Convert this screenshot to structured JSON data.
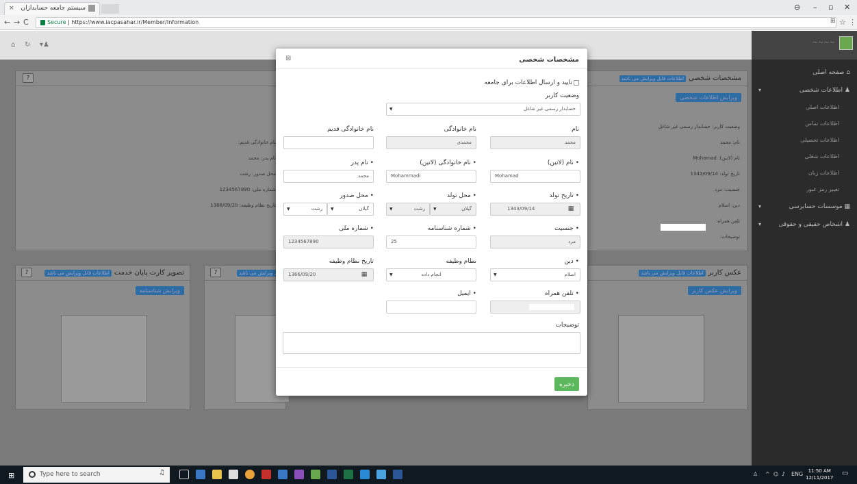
{
  "browser": {
    "tab_title": "سیستم جامعه حسابداران",
    "url_secure": "Secure",
    "url": "https://www.iacpasahar.ir/Member/Information"
  },
  "sidebar": {
    "items": [
      {
        "label": "صفحه اصلی"
      },
      {
        "label": "اطلاعات شخصی"
      }
    ],
    "subitems": [
      "اطلاعات اصلی",
      "اطلاعات تماس",
      "اطلاعات تحصیلی",
      "اطلاعات شغلی",
      "اطلاعات زبان",
      "تغییر رمز عبور"
    ],
    "bottom_items": [
      "موسسات حسابرسی",
      "اشخاص حقیقی و حقوقی"
    ]
  },
  "background": {
    "personal_title": "مشخصات شخصی",
    "editable_badge": "اطلاعات قابل ویرایش می باشد",
    "edit_personal_btn": "ویرایش اطلاعات شخصی",
    "right_lines": [
      "وضعیت کاربر: حسابدار رسمی غیر شاغل",
      "نام: محمد",
      "نام (لاتین): Mohamad",
      "تاریخ تولد: 1343/09/14",
      "جنسیت: مرد",
      "دین: اسلام",
      "تلفن همراه:",
      "توضیحات:"
    ],
    "left_lines": [
      "نام خانوادگی قدیم:",
      "نام پدر: محمد",
      "محل صدور: رشت",
      "شماره ملی: 1234567890",
      "تاریخ نظام وظیفه: 1366/09/20"
    ],
    "user_photo_title": "عکس کاربر",
    "edit_photo_btn": "ویرایش عکس کاربر",
    "service_card_title": "تصویر کارت پایان خدمت",
    "edit_id_btn": "ویرایش شناسنامه",
    "mid_badge": "ل ویرایش می باشد"
  },
  "modal": {
    "title": "مشخصات شخصی",
    "confirm_label": "تایید و ارسال اطلاعات برای جامعه",
    "user_status_label": "وضعیت کاربر",
    "user_status_value": "حسابدار رسمی غیر شاغل",
    "first_name_label": "نام",
    "first_name_value": "محمد",
    "last_name_label": "نام خانوادگی",
    "last_name_value": "محمدی",
    "old_last_name_label": "نام خانوادگی قدیم",
    "old_last_name_value": "",
    "first_name_latin_label": "• نام (لاتین)",
    "first_name_latin_value": "Mohamad",
    "last_name_latin_label": "• نام خانوادگی (لاتین)",
    "last_name_latin_value": "Mohammadi",
    "father_name_label": "• نام پدر",
    "father_name_value": "محمد",
    "birth_date_label": "• تاریخ تولد",
    "birth_date_value": "1343/09/14",
    "birth_place_label": "• محل تولد",
    "birth_province": "گیلان",
    "birth_city": "رشت",
    "issue_place_label": "• محل صدور",
    "issue_province": "گیلان",
    "issue_city": "رشت",
    "gender_label": "• جنسیت",
    "gender_value": "مرد",
    "id_number_label": "• شماره شناسنامه",
    "id_number_value": "25",
    "national_id_label": "• شماره ملی",
    "national_id_value": "1234567890",
    "religion_label": "• دین",
    "religion_value": "اسلام",
    "military_label": "نظام وظیفه",
    "military_value": "انجام داده",
    "military_date_label": "تاریخ نظام وظیفه",
    "military_date_value": "1366/09/20",
    "mobile_label": "• تلفن همراه",
    "email_label": "• ایمیل",
    "email_value": "",
    "description_label": "توضیحات",
    "save_label": "ذخیره"
  },
  "taskbar": {
    "search_placeholder": "Type here to search",
    "lang": "ENG",
    "time": "11:50 AM",
    "date": "12/11/2017"
  }
}
